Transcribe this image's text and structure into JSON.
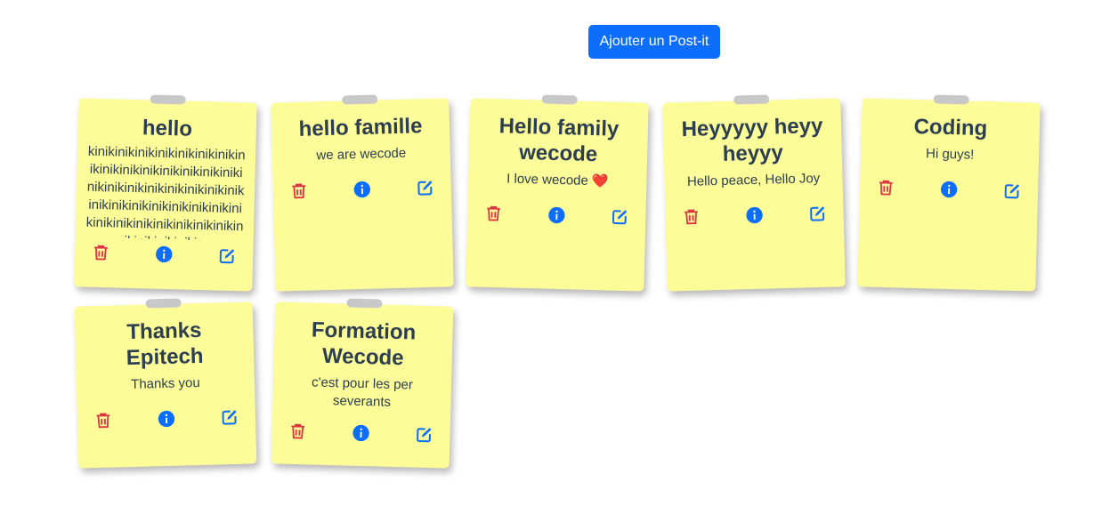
{
  "toolbar": {
    "add_label": "Ajouter un Post-it"
  },
  "notes": [
    {
      "title": "hello",
      "body": "kinikinikinikinikinikinikinikinikinikinikinikinikinikinikinikinikinikinikinikinikinikinikinikinikinikinikinikinikinikinikinikinikinikinikinikinikinikinikinikinikinikinikin"
    },
    {
      "title": "hello famille",
      "body": "we are wecode"
    },
    {
      "title": "Hello family wecode",
      "body": "I love wecode ❤️"
    },
    {
      "title": "Heyyyyy heyy heyyy",
      "body": "Hello peace, Hello Joy"
    },
    {
      "title": "Coding",
      "body": "Hi guys!"
    },
    {
      "title": "Thanks Epitech",
      "body": "Thanks you"
    },
    {
      "title": "Formation Wecode",
      "body": "c'est pour les perseverants"
    }
  ],
  "icons": {
    "delete": "trash-icon",
    "info": "info-icon",
    "edit": "edit-icon"
  },
  "colors": {
    "note_background": "#fcfc99",
    "text": "#2d3e50",
    "primary": "#0d6efd",
    "delete": "#dc3545",
    "tape": "#c8c8c8"
  }
}
